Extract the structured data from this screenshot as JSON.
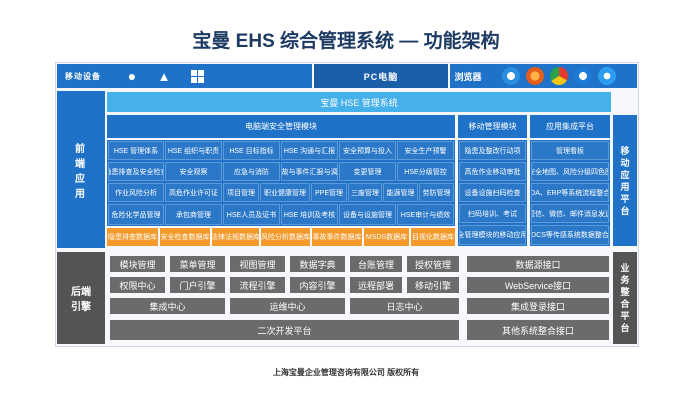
{
  "title": "宝曼 EHS 综合管理系统 — 功能架构",
  "top_bar": {
    "mobile_label": "移动设备",
    "pc_label": "PC电脑",
    "browser_label": "浏览器"
  },
  "front": {
    "side_label": "前端应用",
    "hse_system": "宝曼 HSE 管理系统",
    "pc_module_title": "电脑端安全管理模块",
    "mobile_module_title": "移动管理模块",
    "integration_title": "应用集成平台",
    "pc_rows": [
      [
        "HSE 管理体系",
        "HSE 组织与职责",
        "HSE 目标指标",
        "HSE 沟通与汇报",
        "安全预算与投入",
        "安全生产预警"
      ],
      [
        "隐患排查及安全检查",
        "安全观察",
        "应急与消防",
        "事故与事件汇报与调查",
        "变更管理",
        "HSE分级管控"
      ],
      [
        "作业风险分析",
        "高危作业许可证",
        "项目管理",
        "职业健康管理",
        "PPE管理",
        "三废管理",
        "能源管理",
        "劳防管理"
      ],
      [
        "危险化学品管理",
        "承包商管理",
        "HSE人员及证书",
        "HSE 培训及考核",
        "设备与设施管理",
        "HSE审计与绩效"
      ]
    ],
    "orange_row": [
      "隐患排查数据库",
      "安全检查数据库",
      "法律法规数据库",
      "风险分析数据库",
      "事故事件数据库",
      "MSDS数据库",
      "目视化数据库"
    ],
    "mobile_items": [
      "隐患及整改行动项",
      "高危作业移动审批",
      "设备设施扫码检查",
      "扫码培训、考试",
      "全管理模块的移动应用"
    ],
    "integration_items": [
      "管理看板",
      "安全地图、风险分级四色图",
      "OA、ERP等系统流程整合",
      "短信、微信、邮件消息发送",
      "DCS等传感系统数据整合"
    ],
    "right_side_label": "移动应用平台"
  },
  "back": {
    "side_label": "后端引擎",
    "left_rows": [
      [
        "模块管理",
        "菜单管理",
        "视图管理",
        "数据字典",
        "台账管理",
        "授权管理"
      ],
      [
        "权限中心",
        "门户引擎",
        "流程引擎",
        "内容引擎",
        "远程部署",
        "移动引擎"
      ]
    ],
    "row3": [
      "集成中心",
      "运维中心",
      "日志中心"
    ],
    "bottom": "二次开发平台",
    "right_items": [
      "数据源接口",
      "WebService接口",
      "集成登录接口",
      "其他系统整合接口"
    ],
    "right_side_label": "业务整合平台"
  },
  "footer": "上海宝曼企业管理咨询有限公司 版权所有",
  "colors": {
    "primary": "#1f72c7",
    "sky": "#46b0ea",
    "orange": "#f39a2a",
    "gray": "#6b6b6b"
  }
}
